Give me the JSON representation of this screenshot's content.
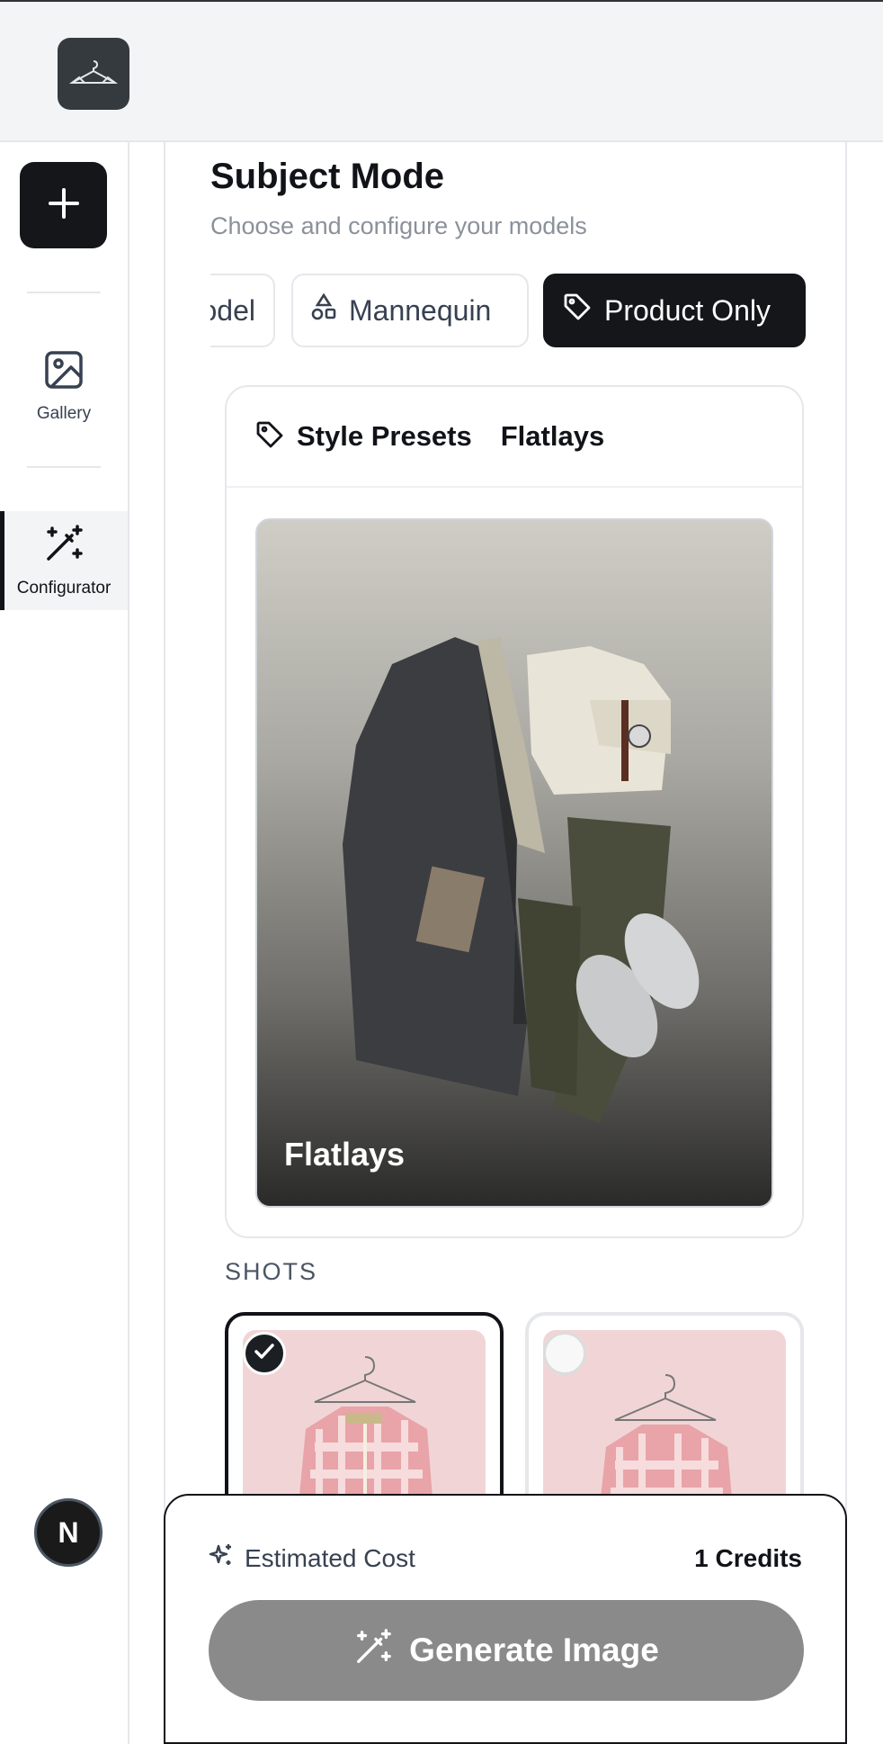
{
  "sidebar": {
    "new_label": "+",
    "items": [
      {
        "label": "Gallery",
        "icon": "image-icon"
      },
      {
        "label": "Configurator",
        "icon": "magic-wand-icon"
      }
    ],
    "avatar_letter": "N"
  },
  "main": {
    "title": "Subject Mode",
    "subtitle": "Choose and configure your models",
    "modes": [
      {
        "label": "Model",
        "visible_text": "odel",
        "icon": "person-icon",
        "active": false
      },
      {
        "label": "Mannequin",
        "icon": "shapes-icon",
        "active": false
      },
      {
        "label": "Product Only",
        "icon": "tag-icon",
        "active": true
      }
    ],
    "preset": {
      "label": "Style Presets",
      "value": "Flatlays",
      "image_caption": "Flatlays"
    },
    "shots_label": "SHOTS",
    "shots": [
      {
        "selected": true
      },
      {
        "selected": false
      }
    ]
  },
  "footer": {
    "cost_label": "Estimated Cost",
    "cost_value": "1 Credits",
    "generate_label": "Generate Image"
  },
  "colors": {
    "primary": "#141619",
    "muted_text": "#8b919a",
    "disabled_button": "#8a8a8a",
    "border": "#e5e7eb"
  }
}
